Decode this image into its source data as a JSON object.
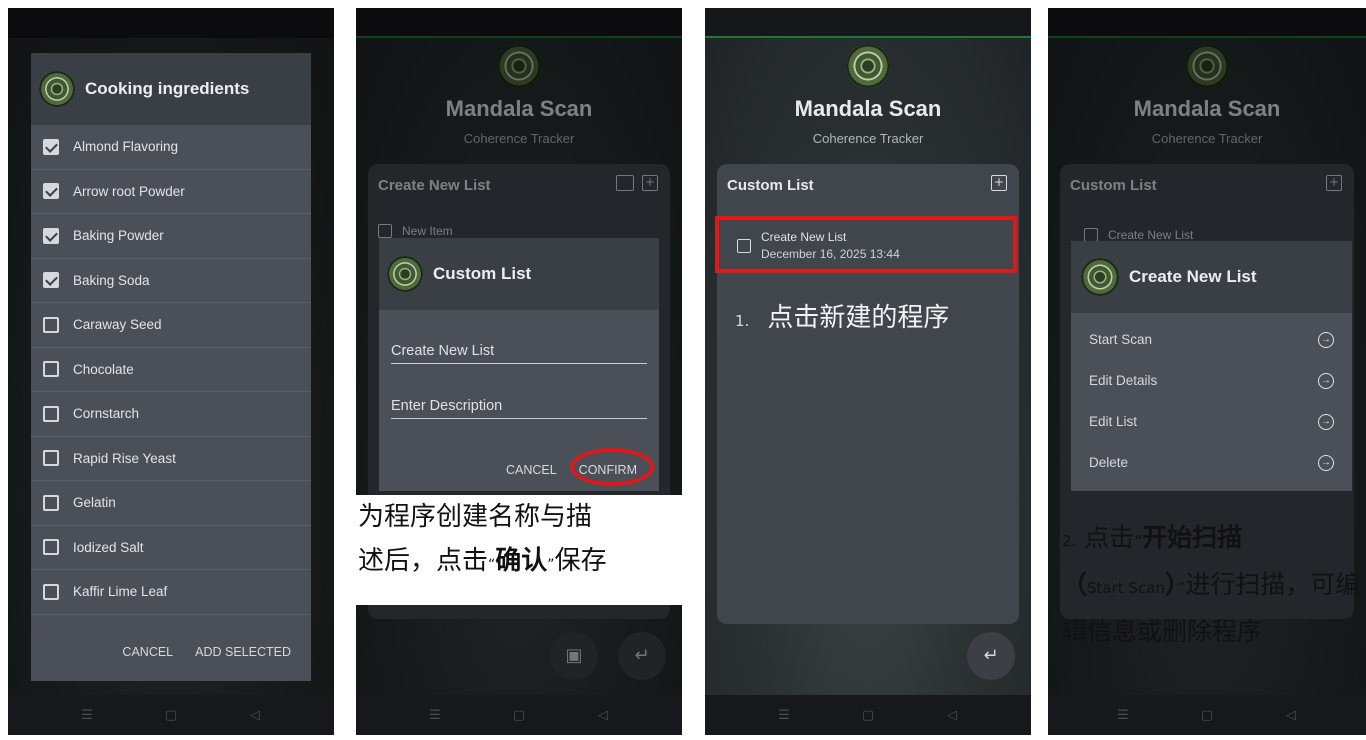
{
  "app": {
    "title": "Mandala Scan",
    "subtitle": "Coherence Tracker"
  },
  "panel1": {
    "dialog_title": "Cooking ingredients",
    "items": [
      {
        "label": "Almond Flavoring",
        "checked": true
      },
      {
        "label": "Arrow root Powder",
        "checked": true
      },
      {
        "label": "Baking Powder",
        "checked": true
      },
      {
        "label": "Baking Soda",
        "checked": true
      },
      {
        "label": "Caraway Seed",
        "checked": false
      },
      {
        "label": "Chocolate",
        "checked": false
      },
      {
        "label": "Cornstarch",
        "checked": false
      },
      {
        "label": "Rapid Rise Yeast",
        "checked": false
      },
      {
        "label": "Gelatin",
        "checked": false
      },
      {
        "label": "Iodized Salt",
        "checked": false
      },
      {
        "label": "Kaffir Lime Leaf",
        "checked": false
      }
    ],
    "cancel_label": "CANCEL",
    "add_label": "ADD SELECTED"
  },
  "panel2": {
    "card_title": "Create New List",
    "new_item": "New Item",
    "dialog_title": "Custom List",
    "name_field": "Create New List",
    "desc_field": "Enter Description",
    "cancel_label": "CANCEL",
    "confirm_label": "CONFIRM",
    "caption_line1": "为程序创建名称与描",
    "caption_line2_pre": "述后，点击",
    "caption_line2_open": "“",
    "caption_line2_bold": "确认",
    "caption_line2_close": "”",
    "caption_line2_post": "保存"
  },
  "panel3": {
    "card_title": "Custom List",
    "item_title": "Create New List",
    "item_date": "December 16, 2025 13:44",
    "step_num": "1.",
    "step_text": "点击新建的程序"
  },
  "panel4": {
    "card_title": "Custom List",
    "item_title": "Create New List",
    "dialog_title": "Create New List",
    "menu": [
      "Start Scan",
      "Edit Details",
      "Edit List",
      "Delete"
    ],
    "cap_num": "2.",
    "cap_pre": "点击",
    "cap_open": "“",
    "cap_bold": "开始扫描",
    "cap_paren_open": "（",
    "cap_en": "Start Scan",
    "cap_paren_close": "）",
    "cap_close": "”",
    "cap_post": "进行扫描，可编辑信息或删除程序"
  },
  "colors": {
    "highlight": "#e01818",
    "card": "#41464d",
    "dialog": "#4b5058"
  },
  "icons": {
    "back": "return-arrow-icon",
    "save": "save-icon",
    "add": "add-box-icon"
  }
}
